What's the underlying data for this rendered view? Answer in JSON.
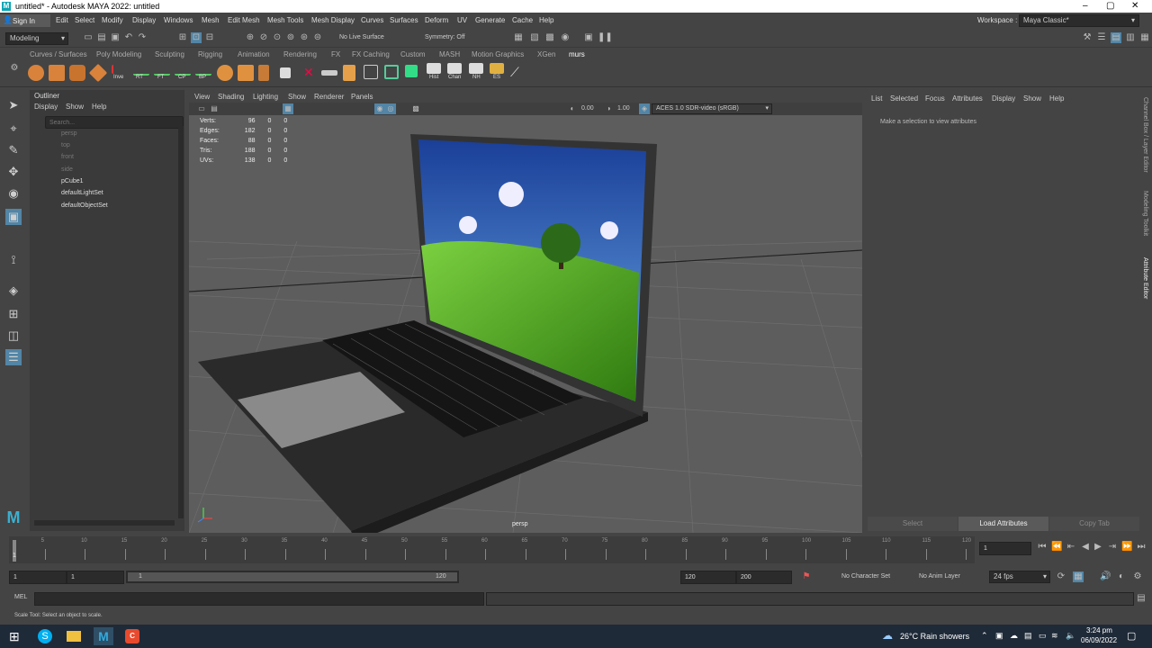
{
  "window": {
    "title": "untitled* - Autodesk MAYA 2022: untitled",
    "logo": "M"
  },
  "menubar": {
    "sign_in": "Sign In",
    "items": [
      "File",
      "Edit",
      "Select",
      "Modify",
      "Display",
      "Windows",
      "Mesh",
      "Edit Mesh",
      "Mesh Tools",
      "Mesh Display",
      "Curves",
      "Surfaces",
      "Deform",
      "UV",
      "Generate",
      "Cache",
      "Help"
    ],
    "workspace_label": "Workspace :",
    "workspace_value": "Maya Classic*"
  },
  "statusline": {
    "mode": "Modeling",
    "live_surface": "No Live Surface",
    "symmetry": "Symmetry: Off"
  },
  "shelf": {
    "tabs": [
      "Curves / Surfaces",
      "Poly Modeling",
      "Sculpting",
      "Rigging",
      "Animation",
      "Rendering",
      "FX",
      "FX Caching",
      "Custom",
      "MASH",
      "Motion Graphics",
      "XGen",
      "murs"
    ],
    "active_tab": "murs",
    "labels": [
      "Inve",
      "RT",
      "FT",
      "CP",
      "BP",
      "Hist",
      "Chan",
      "NH",
      "ES"
    ]
  },
  "outliner": {
    "title": "Outliner",
    "menu": [
      "Display",
      "Show",
      "Help"
    ],
    "search_placeholder": "Search...",
    "items": [
      "persp",
      "top",
      "front",
      "side",
      "pCube1",
      "defaultLightSet",
      "defaultObjectSet"
    ]
  },
  "viewport": {
    "menu": [
      "View",
      "Shading",
      "Lighting",
      "Show",
      "Renderer",
      "Panels"
    ],
    "gamma1": "0.00",
    "gamma2": "1.00",
    "colorspace": "ACES 1.0 SDR-video (sRGB)",
    "camera": "persp",
    "hud": [
      {
        "label": "Verts:",
        "a": "96",
        "b": "0",
        "c": "0"
      },
      {
        "label": "Edges:",
        "a": "182",
        "b": "0",
        "c": "0"
      },
      {
        "label": "Faces:",
        "a": "88",
        "b": "0",
        "c": "0"
      },
      {
        "label": "Tris:",
        "a": "188",
        "b": "0",
        "c": "0"
      },
      {
        "label": "UVs:",
        "a": "138",
        "b": "0",
        "c": "0"
      }
    ]
  },
  "attribute_editor": {
    "menu": [
      "List",
      "Selected",
      "Focus",
      "Attributes",
      "Display",
      "Show",
      "Help"
    ],
    "message": "Make a selection to view attributes",
    "buttons": [
      "Select",
      "Load Attributes",
      "Copy Tab"
    ]
  },
  "side_tabs": [
    "Channel Box / Layer Editor",
    "Modeling Toolkit",
    "Attribute Editor"
  ],
  "timeline": {
    "ticks": [
      "1",
      "5",
      "10",
      "15",
      "20",
      "25",
      "30",
      "35",
      "40",
      "45",
      "50",
      "55",
      "60",
      "65",
      "70",
      "75",
      "80",
      "85",
      "90",
      "95",
      "100",
      "105",
      "110",
      "115",
      "120"
    ],
    "current_frame": "1"
  },
  "range": {
    "start": "1",
    "playback_start": "1",
    "slider_start": "1",
    "slider_end": "120",
    "playback_end": "120",
    "end": "200",
    "character_set": "No Character Set",
    "anim_layer": "No Anim Layer",
    "fps": "24 fps"
  },
  "command": {
    "label": "MEL"
  },
  "help_line": "Scale Tool: Select an object to scale.",
  "taskbar": {
    "weather": "26°C  Rain showers",
    "time": "3:24 pm",
    "date": "06/09/2022"
  },
  "colors": {
    "accent": "#5285a6",
    "viewport_bg": "#5d5d5d"
  }
}
